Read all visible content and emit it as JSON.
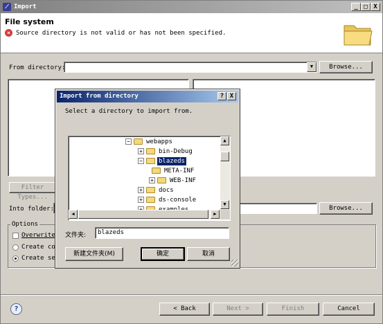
{
  "window": {
    "title": "Import",
    "controls": {
      "minimize": "_",
      "maximize": "□",
      "close": "X"
    }
  },
  "header": {
    "title": "File system",
    "message": "Source directory is not valid or has not been specified."
  },
  "from_directory": {
    "label": "From directory:",
    "value": "",
    "browse_label": "Browse..."
  },
  "filter_types_label": "Filter Types...",
  "into_folder": {
    "label": "Into folder:",
    "value": "",
    "browse_label": "Browse..."
  },
  "options": {
    "title": "Options",
    "overwrite_label": "Overwrite",
    "create_complete_label": "Create com",
    "create_selected_label": "Create sel"
  },
  "footer": {
    "help_icon": "?",
    "back_label": "< Back",
    "next_label": "Next >",
    "finish_label": "Finish",
    "cancel_label": "Cancel"
  },
  "dialog": {
    "title": "Import from directory",
    "help_button": "?",
    "close_button": "X",
    "instruction": "Select a directory to import from.",
    "tree": [
      {
        "label": "webapps",
        "expander": "−"
      },
      {
        "label": "bin-Debug",
        "expander": "+"
      },
      {
        "label": "blazeds",
        "expander": "−",
        "selected": true
      },
      {
        "label": "META-INF",
        "expander": ""
      },
      {
        "label": "WEB-INF",
        "expander": "+"
      },
      {
        "label": "docs",
        "expander": "+"
      },
      {
        "label": "ds-console",
        "expander": "+"
      },
      {
        "label": "examples",
        "expander": "+"
      }
    ],
    "folder_label": "文件夹:",
    "folder_value": "blazeds",
    "new_folder_label": "新建文件夹(M)",
    "ok_label": "确定",
    "cancel_label": "取消"
  },
  "colors": {
    "dialog_titlebar": "#0a246a",
    "error_icon": "#d33c3c",
    "tree_selection": "#0a246a"
  }
}
